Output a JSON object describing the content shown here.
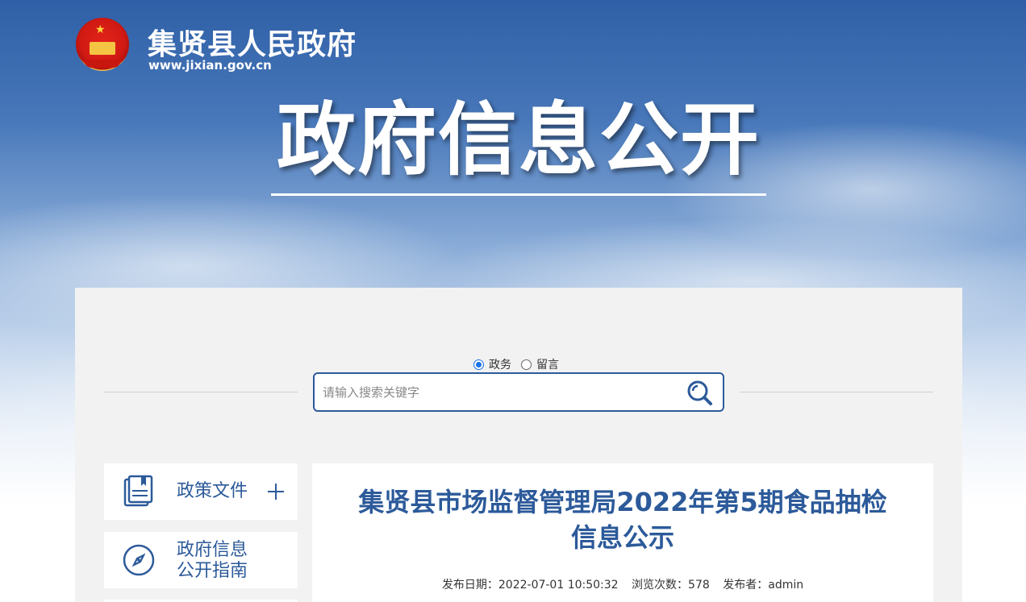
{
  "header": {
    "site_name": "集贤县人民政府",
    "site_url": "www.jixian.gov.cn",
    "banner_title": "政府信息公开"
  },
  "search": {
    "options": [
      {
        "label": "政务",
        "selected": true
      },
      {
        "label": "留言",
        "selected": false
      }
    ],
    "placeholder": "请输入搜索关键字",
    "value": ""
  },
  "sidebar": {
    "items": [
      {
        "label": "政策文件",
        "icon": "document-icon",
        "expandable": true
      },
      {
        "label_line1": "政府信息",
        "label_line2": "公开指南",
        "icon": "compass-icon",
        "expandable": false
      }
    ]
  },
  "article": {
    "title_line1": "集贤县市场监督管理局2022年第5期食品抽检",
    "title_line2": "信息公示",
    "publish_date": "发布日期：2022-07-01 10:50:32",
    "views": "浏览次数：578",
    "author": "发布者：admin"
  },
  "colors": {
    "brand_blue": "#2c5a9a",
    "radio_active": "#1a73e8"
  }
}
